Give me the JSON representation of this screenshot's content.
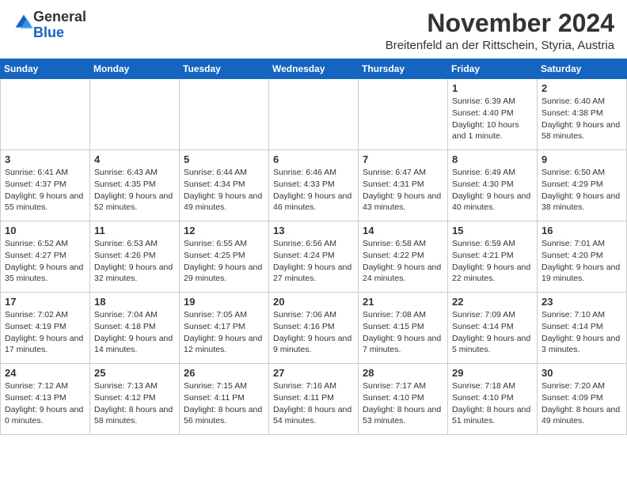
{
  "header": {
    "logo_general": "General",
    "logo_blue": "Blue",
    "month_title": "November 2024",
    "location": "Breitenfeld an der Rittschein, Styria, Austria"
  },
  "weekdays": [
    "Sunday",
    "Monday",
    "Tuesday",
    "Wednesday",
    "Thursday",
    "Friday",
    "Saturday"
  ],
  "weeks": [
    [
      {
        "day": "",
        "info": ""
      },
      {
        "day": "",
        "info": ""
      },
      {
        "day": "",
        "info": ""
      },
      {
        "day": "",
        "info": ""
      },
      {
        "day": "",
        "info": ""
      },
      {
        "day": "1",
        "info": "Sunrise: 6:39 AM\nSunset: 4:40 PM\nDaylight: 10 hours and 1 minute."
      },
      {
        "day": "2",
        "info": "Sunrise: 6:40 AM\nSunset: 4:38 PM\nDaylight: 9 hours and 58 minutes."
      }
    ],
    [
      {
        "day": "3",
        "info": "Sunrise: 6:41 AM\nSunset: 4:37 PM\nDaylight: 9 hours and 55 minutes."
      },
      {
        "day": "4",
        "info": "Sunrise: 6:43 AM\nSunset: 4:35 PM\nDaylight: 9 hours and 52 minutes."
      },
      {
        "day": "5",
        "info": "Sunrise: 6:44 AM\nSunset: 4:34 PM\nDaylight: 9 hours and 49 minutes."
      },
      {
        "day": "6",
        "info": "Sunrise: 6:46 AM\nSunset: 4:33 PM\nDaylight: 9 hours and 46 minutes."
      },
      {
        "day": "7",
        "info": "Sunrise: 6:47 AM\nSunset: 4:31 PM\nDaylight: 9 hours and 43 minutes."
      },
      {
        "day": "8",
        "info": "Sunrise: 6:49 AM\nSunset: 4:30 PM\nDaylight: 9 hours and 40 minutes."
      },
      {
        "day": "9",
        "info": "Sunrise: 6:50 AM\nSunset: 4:29 PM\nDaylight: 9 hours and 38 minutes."
      }
    ],
    [
      {
        "day": "10",
        "info": "Sunrise: 6:52 AM\nSunset: 4:27 PM\nDaylight: 9 hours and 35 minutes."
      },
      {
        "day": "11",
        "info": "Sunrise: 6:53 AM\nSunset: 4:26 PM\nDaylight: 9 hours and 32 minutes."
      },
      {
        "day": "12",
        "info": "Sunrise: 6:55 AM\nSunset: 4:25 PM\nDaylight: 9 hours and 29 minutes."
      },
      {
        "day": "13",
        "info": "Sunrise: 6:56 AM\nSunset: 4:24 PM\nDaylight: 9 hours and 27 minutes."
      },
      {
        "day": "14",
        "info": "Sunrise: 6:58 AM\nSunset: 4:22 PM\nDaylight: 9 hours and 24 minutes."
      },
      {
        "day": "15",
        "info": "Sunrise: 6:59 AM\nSunset: 4:21 PM\nDaylight: 9 hours and 22 minutes."
      },
      {
        "day": "16",
        "info": "Sunrise: 7:01 AM\nSunset: 4:20 PM\nDaylight: 9 hours and 19 minutes."
      }
    ],
    [
      {
        "day": "17",
        "info": "Sunrise: 7:02 AM\nSunset: 4:19 PM\nDaylight: 9 hours and 17 minutes."
      },
      {
        "day": "18",
        "info": "Sunrise: 7:04 AM\nSunset: 4:18 PM\nDaylight: 9 hours and 14 minutes."
      },
      {
        "day": "19",
        "info": "Sunrise: 7:05 AM\nSunset: 4:17 PM\nDaylight: 9 hours and 12 minutes."
      },
      {
        "day": "20",
        "info": "Sunrise: 7:06 AM\nSunset: 4:16 PM\nDaylight: 9 hours and 9 minutes."
      },
      {
        "day": "21",
        "info": "Sunrise: 7:08 AM\nSunset: 4:15 PM\nDaylight: 9 hours and 7 minutes."
      },
      {
        "day": "22",
        "info": "Sunrise: 7:09 AM\nSunset: 4:14 PM\nDaylight: 9 hours and 5 minutes."
      },
      {
        "day": "23",
        "info": "Sunrise: 7:10 AM\nSunset: 4:14 PM\nDaylight: 9 hours and 3 minutes."
      }
    ],
    [
      {
        "day": "24",
        "info": "Sunrise: 7:12 AM\nSunset: 4:13 PM\nDaylight: 9 hours and 0 minutes."
      },
      {
        "day": "25",
        "info": "Sunrise: 7:13 AM\nSunset: 4:12 PM\nDaylight: 8 hours and 58 minutes."
      },
      {
        "day": "26",
        "info": "Sunrise: 7:15 AM\nSunset: 4:11 PM\nDaylight: 8 hours and 56 minutes."
      },
      {
        "day": "27",
        "info": "Sunrise: 7:16 AM\nSunset: 4:11 PM\nDaylight: 8 hours and 54 minutes."
      },
      {
        "day": "28",
        "info": "Sunrise: 7:17 AM\nSunset: 4:10 PM\nDaylight: 8 hours and 53 minutes."
      },
      {
        "day": "29",
        "info": "Sunrise: 7:18 AM\nSunset: 4:10 PM\nDaylight: 8 hours and 51 minutes."
      },
      {
        "day": "30",
        "info": "Sunrise: 7:20 AM\nSunset: 4:09 PM\nDaylight: 8 hours and 49 minutes."
      }
    ]
  ]
}
